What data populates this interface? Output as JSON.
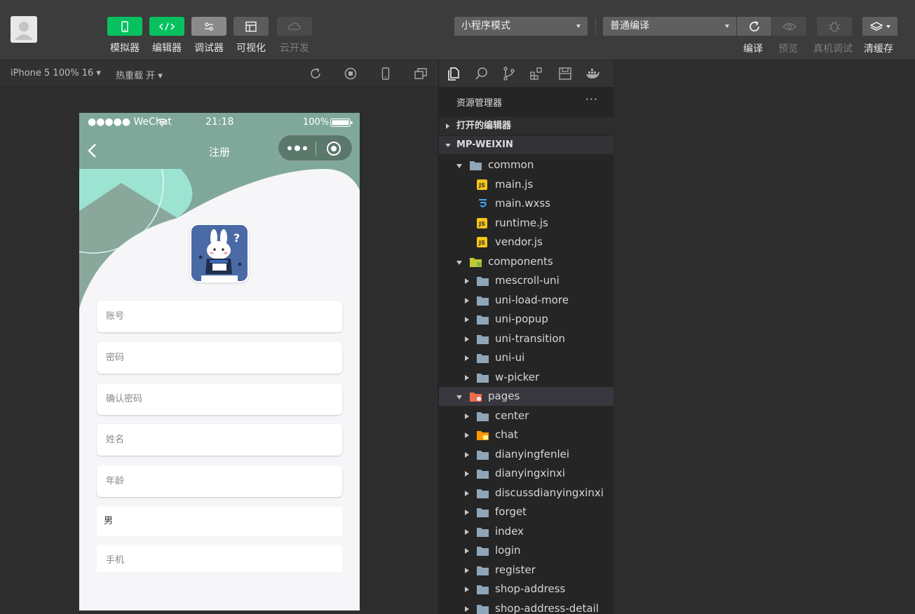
{
  "toolbar": {
    "tools": [
      {
        "label": "模拟器",
        "state": "active"
      },
      {
        "label": "编辑器",
        "state": "active"
      },
      {
        "label": "调试器",
        "state": "normal"
      },
      {
        "label": "可视化",
        "state": "normal"
      },
      {
        "label": "云开发",
        "state": "disabled"
      }
    ],
    "mode_select": "小程序模式",
    "compile_select": "普通编译",
    "actions": [
      {
        "label": "编译",
        "icon": "refresh-icon",
        "enabled": true
      },
      {
        "label": "预览",
        "icon": "eye-icon",
        "enabled": false
      },
      {
        "label": "真机调试",
        "icon": "bug-icon",
        "enabled": false
      },
      {
        "label": "清缓存",
        "icon": "layers-icon",
        "enabled": true
      }
    ],
    "accent_color": "#07c160"
  },
  "simulator_bar": {
    "device": "iPhone 5 100% 16",
    "hot_reload": "热重载 开"
  },
  "phone": {
    "status": {
      "carrier": "●●●●● WeChat",
      "time": "21:18",
      "battery": "100%"
    },
    "nav_title": "注册",
    "fields": [
      {
        "placeholder": "账号"
      },
      {
        "placeholder": "密码"
      },
      {
        "placeholder": "确认密码"
      },
      {
        "placeholder": "姓名"
      },
      {
        "placeholder": "年龄"
      },
      {
        "value": "男"
      },
      {
        "placeholder": "手机"
      }
    ],
    "theme_color": "#7fa89a"
  },
  "explorer": {
    "title": "资源管理器",
    "more": "···",
    "sections": {
      "open_editors": "打开的编辑器",
      "project": "MP-WEIXIN"
    },
    "tree": [
      {
        "label": "common",
        "type": "folder-open",
        "depth": 1,
        "expanded": true
      },
      {
        "label": "main.js",
        "type": "js",
        "depth": 2
      },
      {
        "label": "main.wxss",
        "type": "css",
        "depth": 2
      },
      {
        "label": "runtime.js",
        "type": "js",
        "depth": 2
      },
      {
        "label": "vendor.js",
        "type": "js",
        "depth": 2
      },
      {
        "label": "components",
        "type": "folder-components",
        "depth": 1,
        "expanded": true
      },
      {
        "label": "mescroll-uni",
        "type": "folder",
        "depth": 2
      },
      {
        "label": "uni-load-more",
        "type": "folder",
        "depth": 2
      },
      {
        "label": "uni-popup",
        "type": "folder",
        "depth": 2
      },
      {
        "label": "uni-transition",
        "type": "folder",
        "depth": 2
      },
      {
        "label": "uni-ui",
        "type": "folder",
        "depth": 2
      },
      {
        "label": "w-picker",
        "type": "folder",
        "depth": 2
      },
      {
        "label": "pages",
        "type": "folder-pages",
        "depth": 1,
        "expanded": true,
        "selected": true
      },
      {
        "label": "center",
        "type": "folder",
        "depth": 2
      },
      {
        "label": "chat",
        "type": "folder-chat",
        "depth": 2
      },
      {
        "label": "dianyingfenlei",
        "type": "folder",
        "depth": 2
      },
      {
        "label": "dianyingxinxi",
        "type": "folder",
        "depth": 2
      },
      {
        "label": "discussdianyingxinxi",
        "type": "folder",
        "depth": 2
      },
      {
        "label": "forget",
        "type": "folder",
        "depth": 2
      },
      {
        "label": "index",
        "type": "folder",
        "depth": 2
      },
      {
        "label": "login",
        "type": "folder",
        "depth": 2
      },
      {
        "label": "register",
        "type": "folder",
        "depth": 2
      },
      {
        "label": "shop-address",
        "type": "folder",
        "depth": 2
      },
      {
        "label": "shop-address-detail",
        "type": "folder",
        "depth": 2
      }
    ]
  }
}
